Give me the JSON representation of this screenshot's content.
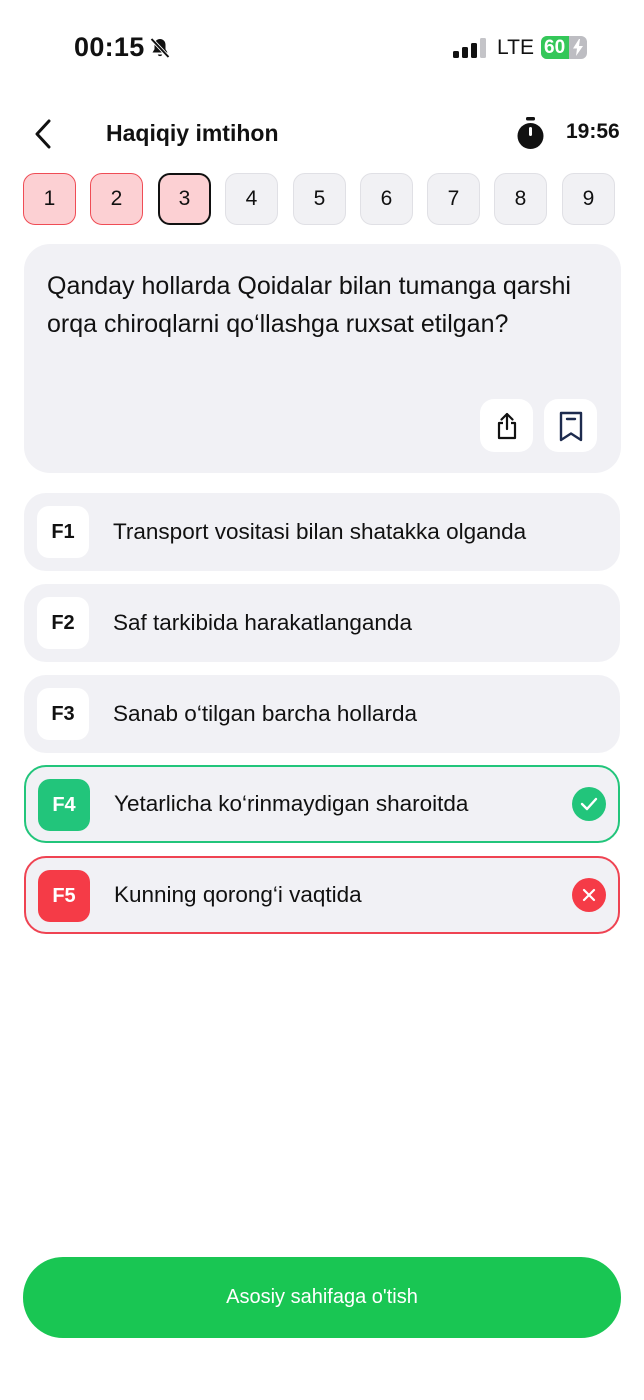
{
  "status_bar": {
    "time": "00:15",
    "network": "LTE",
    "battery_text": "60",
    "battery_level_percent": 60
  },
  "header": {
    "title": "Haqiqiy imtihon",
    "timer": "19:56"
  },
  "question_nav": [
    {
      "label": "1",
      "state": "wrong"
    },
    {
      "label": "2",
      "state": "wrong"
    },
    {
      "label": "3",
      "state": "current"
    },
    {
      "label": "4",
      "state": "default"
    },
    {
      "label": "5",
      "state": "default"
    },
    {
      "label": "6",
      "state": "default"
    },
    {
      "label": "7",
      "state": "default"
    },
    {
      "label": "8",
      "state": "default"
    },
    {
      "label": "9",
      "state": "default"
    }
  ],
  "question": {
    "text": "Qanday hollarda Qoidalar bilan tumanga qarshi orqa chiroqlarni qo‘llashga ruxsat etilgan?"
  },
  "answers": [
    {
      "key": "F1",
      "text": "Transport vositasi bilan shatakka olganda",
      "state": "default"
    },
    {
      "key": "F2",
      "text": "Saf tarkibida harakatlanganda",
      "state": "default"
    },
    {
      "key": "F3",
      "text": "Sanab o‘tilgan barcha hollarda",
      "state": "default"
    },
    {
      "key": "F4",
      "text": "Yetarlicha ko‘rinmaydigan sharoitda",
      "state": "correct"
    },
    {
      "key": "F5",
      "text": "Kunning qorong‘i vaqtida",
      "state": "incorrect"
    }
  ],
  "footer": {
    "home_button_label": "Asosiy sahifaga o'tish"
  },
  "colors": {
    "correct": "#22c57b",
    "incorrect": "#f53b47",
    "primary_button": "#19c653",
    "wrong_nav_bg": "#fcd0d3"
  }
}
